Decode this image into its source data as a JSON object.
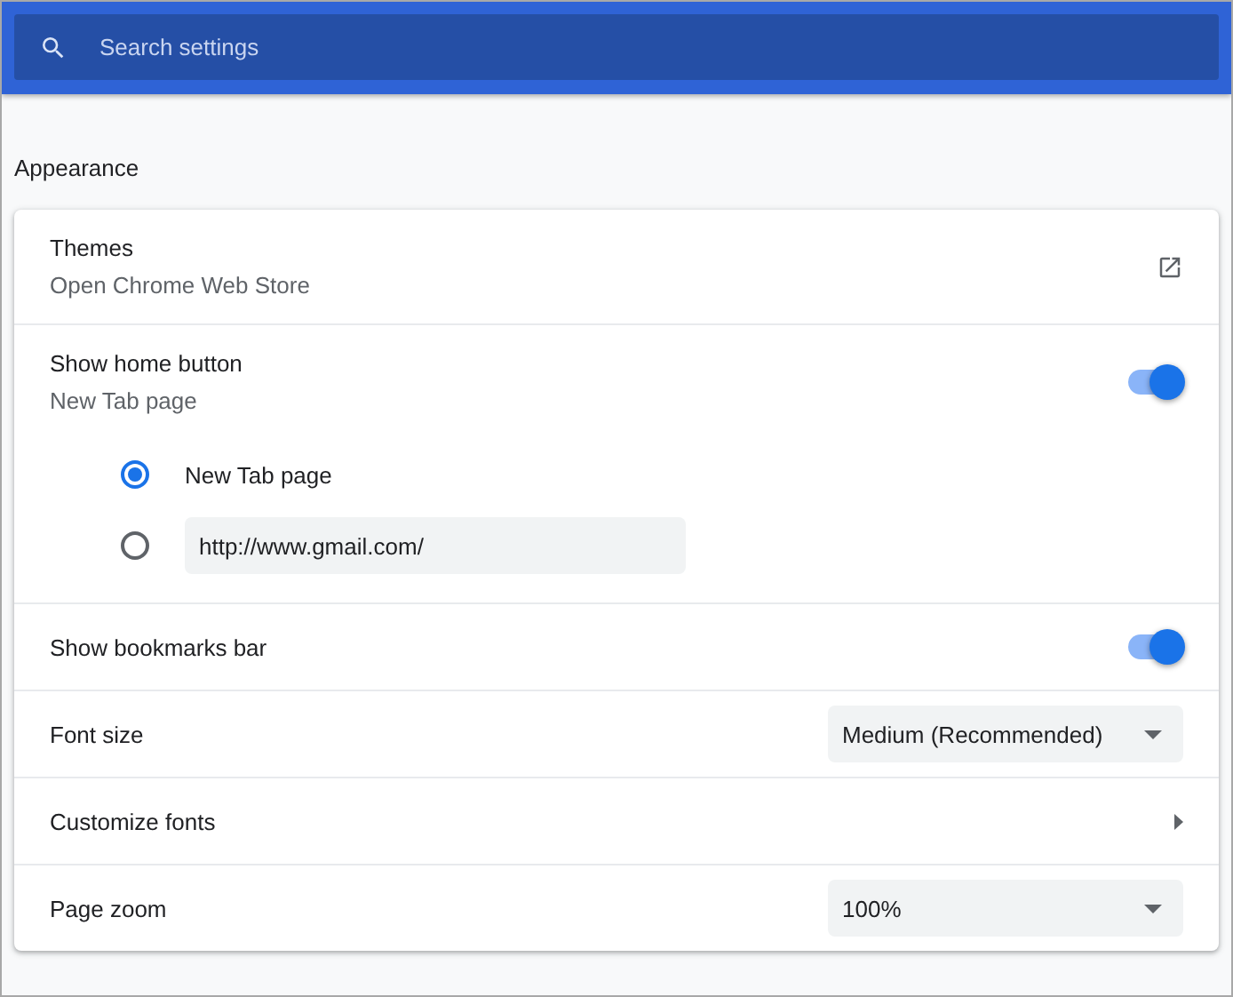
{
  "search": {
    "placeholder": "Search settings"
  },
  "section_title": "Appearance",
  "rows": [
    {
      "kind": "link",
      "label": "Themes",
      "sublabel": "Open Chrome Web Store"
    },
    {
      "kind": "toggle",
      "label": "Show home button",
      "sublabel": "New Tab page",
      "on": true,
      "options": [
        {
          "kind": "radio",
          "label": "New Tab page",
          "selected": true
        },
        {
          "kind": "url",
          "value": "http://www.gmail.com/",
          "selected": false
        }
      ]
    },
    {
      "kind": "toggle",
      "label": "Show bookmarks bar",
      "on": true
    },
    {
      "kind": "select",
      "label": "Font size",
      "value": "Medium (Recommended)"
    },
    {
      "kind": "submenu",
      "label": "Customize fonts"
    },
    {
      "kind": "select",
      "label": "Page zoom",
      "value": "100%"
    }
  ]
}
